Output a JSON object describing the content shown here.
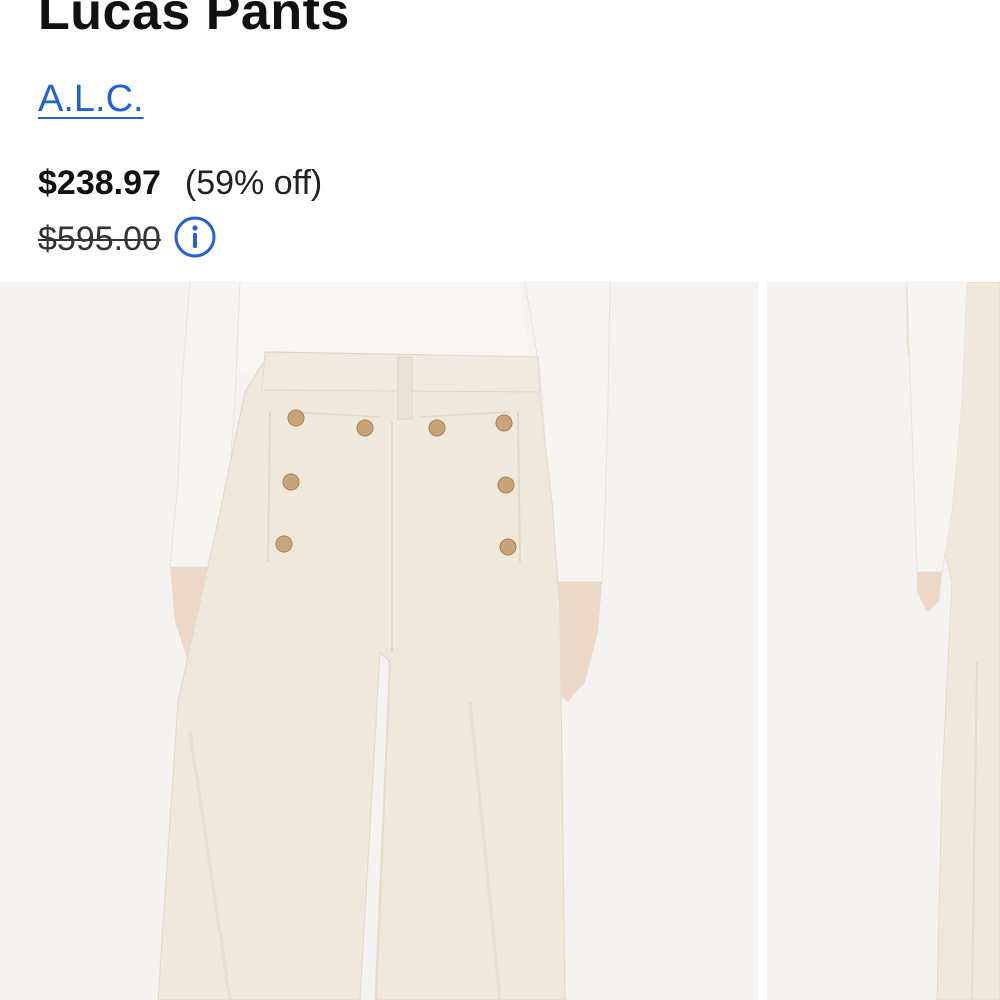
{
  "product": {
    "title": "Lucas Pants",
    "brand": "A.L.C.",
    "sale_price": "$238.97",
    "discount": "(59% off)",
    "original_price": "$595.00"
  },
  "icons": {
    "info": "info-circle-icon"
  },
  "colors": {
    "brand_link": "#1f62d6",
    "photo_background": "#f4f3f1",
    "garment": "#efe9dc"
  },
  "gallery": {
    "images": [
      {
        "alt": "product-photo-front"
      },
      {
        "alt": "product-photo-side"
      }
    ]
  }
}
